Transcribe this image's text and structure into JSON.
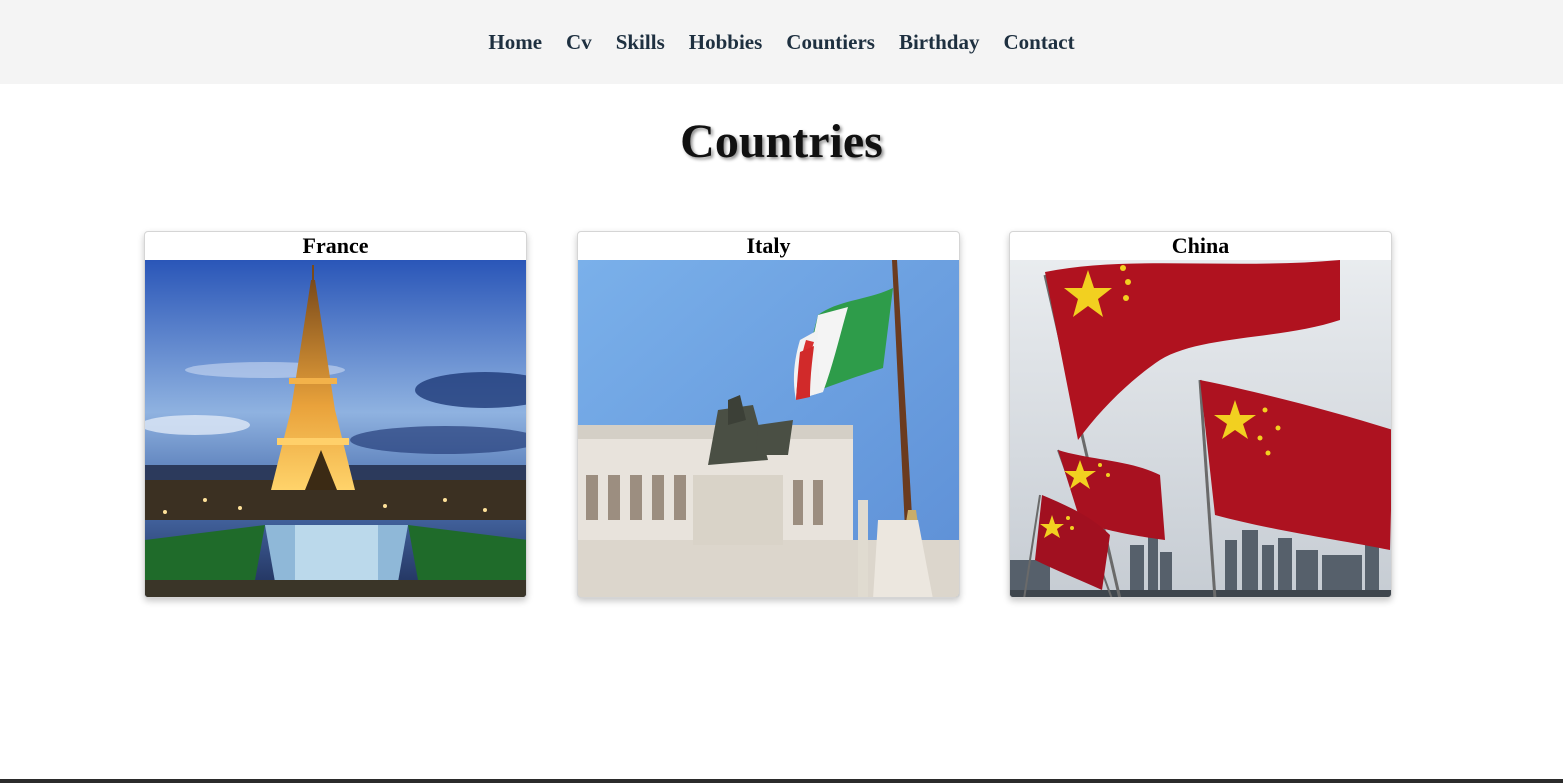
{
  "nav": {
    "items": [
      {
        "label": "Home"
      },
      {
        "label": "Cv"
      },
      {
        "label": "Skills"
      },
      {
        "label": "Hobbies"
      },
      {
        "label": "Countiers"
      },
      {
        "label": "Birthday"
      },
      {
        "label": "Contact"
      }
    ]
  },
  "page": {
    "title": "Countries"
  },
  "cards": [
    {
      "title": "France",
      "image": "eiffel-tower-photo"
    },
    {
      "title": "Italy",
      "image": "italian-flag-monument-photo"
    },
    {
      "title": "China",
      "image": "chinese-flags-skyline-photo"
    }
  ],
  "colors": {
    "nav_bg": "#f4f4f4",
    "nav_text": "#1e3040",
    "flag_red": "#b0121f",
    "flag_yellow": "#f2d020"
  }
}
